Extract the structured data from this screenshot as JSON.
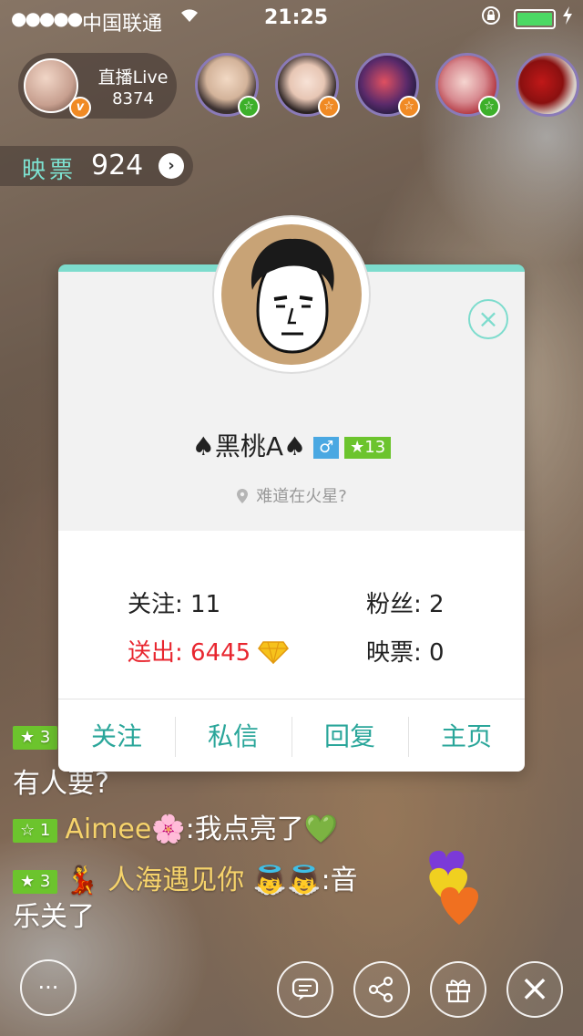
{
  "status_bar": {
    "signal": "●●●●●",
    "carrier": "中国联通",
    "wifi_icon": "wifi-icon",
    "time": "21:25",
    "lock_icon": "orientation-lock-icon",
    "battery_icon": "battery-icon"
  },
  "host": {
    "title": "直播Live",
    "count": "8374",
    "badge": "v"
  },
  "viewers": [
    {
      "badge": "☆",
      "badge_color": "green"
    },
    {
      "badge": "☆",
      "badge_color": "orange"
    },
    {
      "badge": "☆",
      "badge_color": "orange"
    },
    {
      "badge": "☆",
      "badge_color": "green"
    },
    {
      "badge": "",
      "badge_color": ""
    }
  ],
  "ticket": {
    "label": "映票",
    "value": "924",
    "arrow": "›"
  },
  "profile": {
    "name": "♠黑桃A♠",
    "gender": "♂",
    "level": "★13",
    "location": "难道在火星?",
    "stats": {
      "follow_label": "关注:",
      "follow_value": "11",
      "fans_label": "粉丝:",
      "fans_value": "2",
      "sent_label": "送出:",
      "sent_value": "6445",
      "ticket_label": "映票:",
      "ticket_value": "0"
    },
    "actions": {
      "follow": "关注",
      "message": "私信",
      "reply": "回复",
      "home": "主页"
    },
    "close": "×"
  },
  "chat": [
    {
      "level": "★ 3",
      "text": "有人要?"
    },
    {
      "level": "☆ 1",
      "user": "Aimee🌸",
      "text": ":我点亮了💚"
    },
    {
      "level": "★ 3",
      "user": "💃 人海遇见你 👼👼",
      "text": ":音",
      "text2": "乐关了"
    }
  ],
  "controls": {
    "chat": "···",
    "comment": "▤",
    "share": "share-icon",
    "gift": "gift-icon",
    "close": "×"
  },
  "colors": {
    "accent": "#7ddccd",
    "action_text": "#2aa69a",
    "sent_red": "#e8262f",
    "level_green": "#6cc42d"
  }
}
